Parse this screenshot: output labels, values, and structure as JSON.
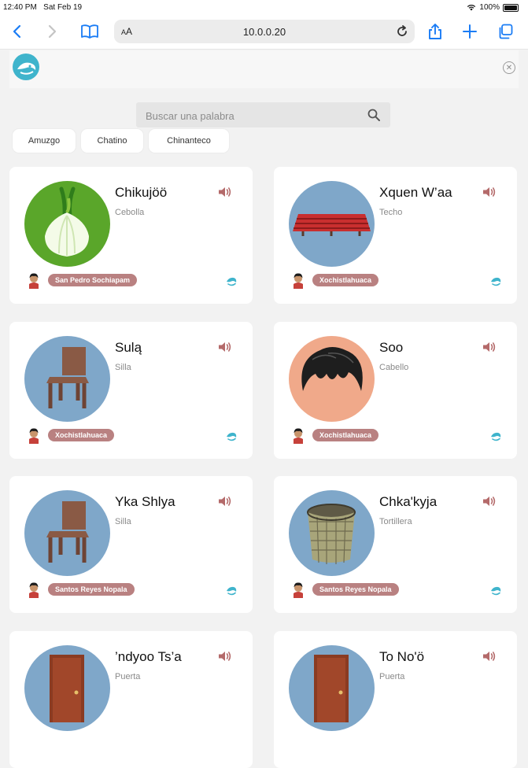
{
  "status_bar": {
    "time": "12:40 PM",
    "date": "Sat Feb 19",
    "battery": "100%"
  },
  "browser": {
    "text_size_label": "AA",
    "url": "10.0.0.20",
    "icons": [
      "back-icon",
      "forward-icon",
      "bookmarks-icon",
      "reload-icon",
      "share-icon",
      "new-tab-icon",
      "tabs-icon"
    ]
  },
  "search": {
    "placeholder": "Buscar una palabra"
  },
  "filters": [
    "Amuzgo",
    "Chatino",
    "Chinanteco"
  ],
  "cards": [
    {
      "word": "Chikujöö",
      "translation": "Cebolla",
      "location": "San Pedro Sochiapam",
      "image": "onion"
    },
    {
      "word": "Xquen W’aa",
      "translation": "Techo",
      "location": "Xochistlahuaca",
      "image": "roof"
    },
    {
      "word": "Sulą",
      "translation": "Silla",
      "location": "Xochistlahuaca",
      "image": "chair"
    },
    {
      "word": "Soo",
      "translation": "Cabello",
      "location": "Xochistlahuaca",
      "image": "hair"
    },
    {
      "word": "Yka Shlya",
      "translation": "Silla",
      "location": "Santos Reyes Nopala",
      "image": "chair"
    },
    {
      "word": "Chka'kyja",
      "translation": "Tortillera",
      "location": "Santos Reyes Nopala",
      "image": "basket"
    },
    {
      "word": "’ndyoo Ts’a",
      "translation": "Puerta",
      "location": "",
      "image": "door"
    },
    {
      "word": "To No'ö",
      "translation": "Puerta",
      "location": "",
      "image": "door"
    }
  ],
  "colors": {
    "accent": "#3fb4cc",
    "tag": "#b98181",
    "speaker": "#b46a6a",
    "nav_blue": "#1a7cf5"
  }
}
